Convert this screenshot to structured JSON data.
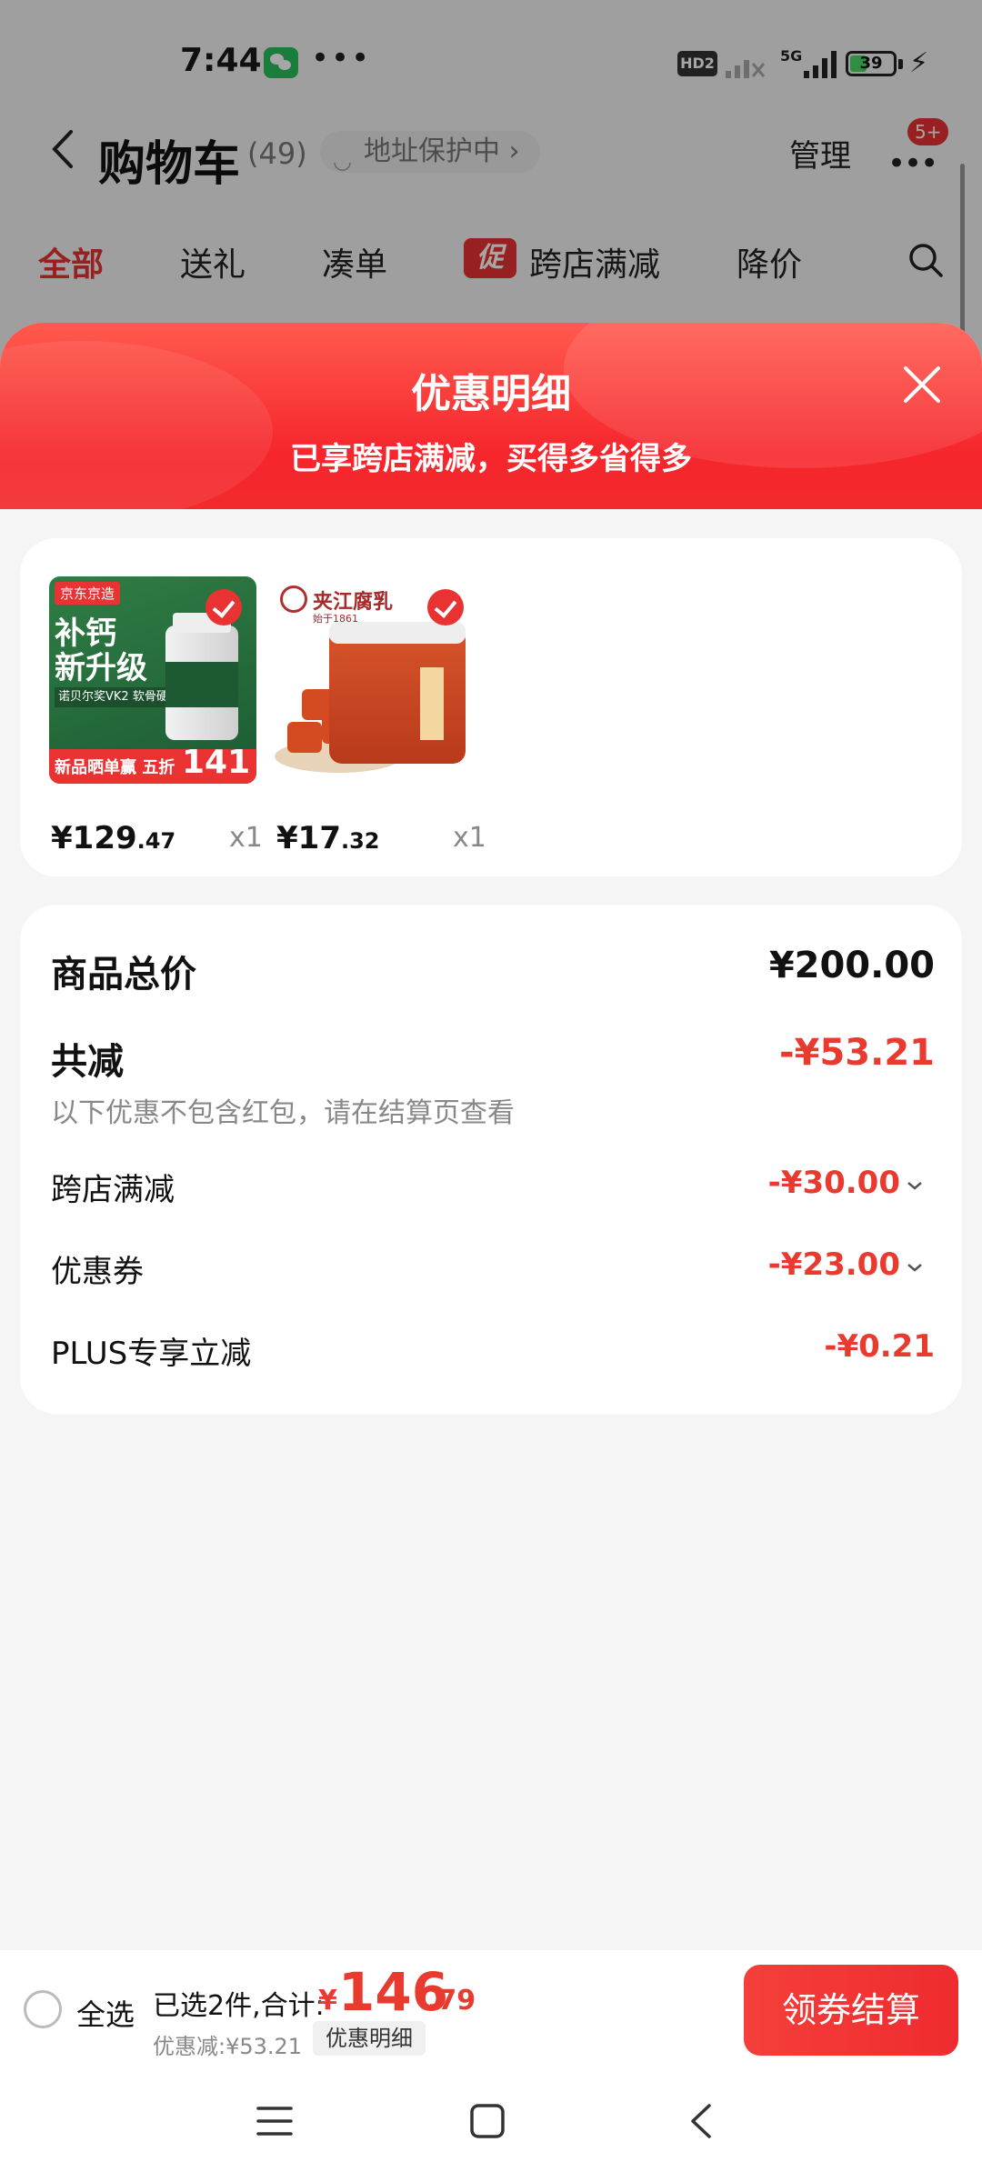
{
  "status_bar": {
    "time": "7:44",
    "more_dots": "•••",
    "hd_label": "HD2",
    "network": "5G",
    "battery": "39",
    "battery_level": 0.39
  },
  "cart_header": {
    "title": "购物车",
    "count": "(49)",
    "address_protect": "地址保护中 ›",
    "manage": "管理",
    "more_badge": "5+"
  },
  "cart_tabs": {
    "items": [
      {
        "label": "全部",
        "active": true
      },
      {
        "label": "送礼",
        "active": false
      },
      {
        "label": "凑单",
        "active": false
      },
      {
        "label": "跨店满减",
        "active": false,
        "tag": "促"
      },
      {
        "label": "降价",
        "active": false
      }
    ]
  },
  "sheet": {
    "title": "优惠明细",
    "subtitle": "已享跨店满减，买得多省得多"
  },
  "products": [
    {
      "price_int": "¥129",
      "price_dec": ".47",
      "qty": "x1",
      "image": {
        "brand": "京东京造",
        "headline_1": "补钙",
        "headline_2": "新升级",
        "sub": "诺贝尔奖VK2 软骨硬骨同补",
        "promo": "新品晒单赢 五折",
        "promo_num": "141"
      }
    },
    {
      "price_int": "¥17",
      "price_dec": ".32",
      "qty": "x1",
      "image": {
        "brand": "夹江腐乳",
        "brand_sub": "始于1861"
      }
    }
  ],
  "summary": {
    "total_label": "商品总价",
    "total_value": "¥200.00",
    "reduce_label": "共减",
    "reduce_value": "-¥53.21",
    "hint": "以下优惠不包含红包，请在结算页查看",
    "rows": [
      {
        "label": "跨店满减",
        "value": "-¥30.00",
        "expandable": true
      },
      {
        "label": "优惠券",
        "value": "-¥23.00",
        "expandable": true
      },
      {
        "label": "PLUS专享立减",
        "value": "-¥0.21",
        "expandable": false
      }
    ]
  },
  "bottom_bar": {
    "select_all": "全选",
    "selected_text": "已选2件,合计:",
    "currency": "¥",
    "total_int": "146",
    "total_dec": ".79",
    "discount_text": "优惠减:¥53.21",
    "detail_chip": "优惠明细",
    "checkout": "领券结算"
  },
  "colors": {
    "accent_red": "#e83a2f",
    "header_gradient_top": "#ff5a4e",
    "header_gradient_bottom": "#f22a2c"
  }
}
